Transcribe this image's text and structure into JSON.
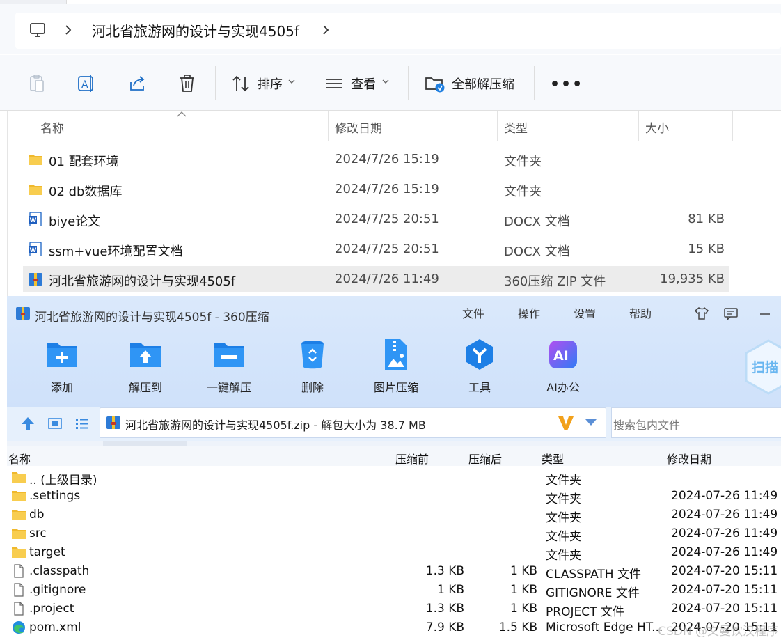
{
  "explorer": {
    "breadcrumb": {
      "folder": "河北省旅游网的设计与实现4505f"
    },
    "toolbar": {
      "sort_label": "排序",
      "view_label": "查看",
      "extract_all_label": "全部解压缩",
      "more_label": "•••"
    },
    "columns": {
      "name": "名称",
      "modified": "修改日期",
      "type": "类型",
      "size": "大小"
    },
    "files": [
      {
        "name": "01 配套环境",
        "modified": "2024/7/26 15:19",
        "type": "文件夹",
        "size": "",
        "icon": "folder-icon"
      },
      {
        "name": "02 db数据库",
        "modified": "2024/7/26 15:19",
        "type": "文件夹",
        "size": "",
        "icon": "folder-icon"
      },
      {
        "name": "biye论文",
        "modified": "2024/7/25 20:51",
        "type": "DOCX 文档",
        "size": "81 KB",
        "icon": "word-doc-icon"
      },
      {
        "name": "ssm+vue环境配置文档",
        "modified": "2024/7/25 20:51",
        "type": "DOCX 文档",
        "size": "15 KB",
        "icon": "word-doc-icon"
      },
      {
        "name": "河北省旅游网的设计与实现4505f",
        "modified": "2024/7/26 11:49",
        "type": "360压缩 ZIP 文件",
        "size": "19,935 KB",
        "icon": "zip-archive-icon",
        "selected": true
      }
    ]
  },
  "zip": {
    "title": "河北省旅游网的设计与实现4505f - 360压缩",
    "menu": {
      "file": "文件",
      "operate": "操作",
      "settings": "设置",
      "help": "帮助"
    },
    "actions": {
      "add": "添加",
      "extract_to": "解压到",
      "one_click": "一键解压",
      "delete": "删除",
      "image_compress": "图片压缩",
      "tools": "工具",
      "ai_office": "AI办公"
    },
    "scan_label": "扫描",
    "path": "河北省旅游网的设计与实现4505f.zip - 解包大小为 38.7 MB",
    "search_placeholder": "搜索包内文件",
    "columns": {
      "name": "名称",
      "before": "压缩前",
      "after": "压缩后",
      "type": "类型",
      "modified": "修改日期"
    },
    "entries": [
      {
        "name": ".. (上级目录)",
        "before": "",
        "after": "",
        "type": "文件夹",
        "modified": "",
        "icon": "folder-icon"
      },
      {
        "name": ".settings",
        "before": "",
        "after": "",
        "type": "文件夹",
        "modified": "2024-07-26 11:49",
        "icon": "folder-icon"
      },
      {
        "name": "db",
        "before": "",
        "after": "",
        "type": "文件夹",
        "modified": "2024-07-26 11:49",
        "icon": "folder-icon"
      },
      {
        "name": "src",
        "before": "",
        "after": "",
        "type": "文件夹",
        "modified": "2024-07-26 11:49",
        "icon": "folder-icon"
      },
      {
        "name": "target",
        "before": "",
        "after": "",
        "type": "文件夹",
        "modified": "2024-07-26 11:49",
        "icon": "folder-icon"
      },
      {
        "name": ".classpath",
        "before": "1.3 KB",
        "after": "1 KB",
        "type": "CLASSPATH 文件",
        "modified": "2024-07-20 15:11",
        "icon": "file-icon"
      },
      {
        "name": ".gitignore",
        "before": "1 KB",
        "after": "1 KB",
        "type": "GITIGNORE 文件",
        "modified": "2024-07-20 15:11",
        "icon": "file-icon"
      },
      {
        "name": ".project",
        "before": "1.3 KB",
        "after": "1 KB",
        "type": "PROJECT 文件",
        "modified": "2024-07-20 15:11",
        "icon": "file-icon"
      },
      {
        "name": "pom.xml",
        "before": "7.9 KB",
        "after": "1.5 KB",
        "type": "Microsoft Edge HT...",
        "modified": "2024-07-20 15:11",
        "icon": "edge-icon"
      }
    ]
  },
  "watermark": "CSDN @文曼饮汉程序",
  "colors": {
    "folder": "#f5c542",
    "zip_header": "#d3e4fb",
    "accent_blue": "#1f7fe0",
    "selected_row": "#ececec"
  }
}
